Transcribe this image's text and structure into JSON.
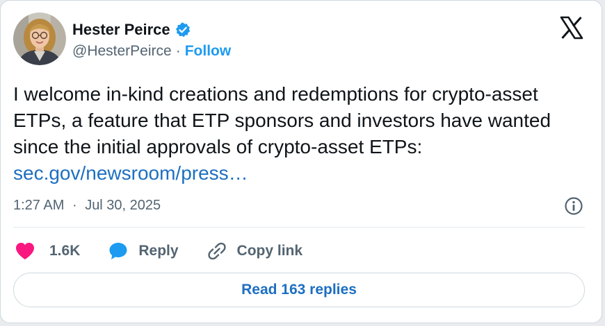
{
  "author": {
    "name": "Hester Peirce",
    "handle": "@HesterPeirce",
    "separator": "·",
    "follow_label": "Follow",
    "verified": true
  },
  "tweet": {
    "text": "I welcome in-kind creations and redemptions for crypto-asset ETPs, a feature that ETP sponsors and investors have wanted since the initial approvals of crypto-asset ETPs:",
    "link_text": "sec.gov/newsroom/press…",
    "time": "1:27 AM",
    "separator": "·",
    "date": "Jul 30, 2025"
  },
  "actions": {
    "like_count": "1.6K",
    "reply_label": "Reply",
    "copy_link_label": "Copy link"
  },
  "read_replies_label": "Read 163 replies",
  "icons": {
    "logo": "x-logo-icon",
    "verified": "verified-badge-icon",
    "info": "info-icon",
    "like": "heart-icon",
    "reply": "speech-bubble-icon",
    "copy_link": "link-icon"
  },
  "colors": {
    "link": "#1d6fc1",
    "follow": "#1d9bf0",
    "verified": "#1d9bf0",
    "heart": "#f91880",
    "reply_bubble": "#1d9bf0",
    "secondary_text": "#536471"
  }
}
